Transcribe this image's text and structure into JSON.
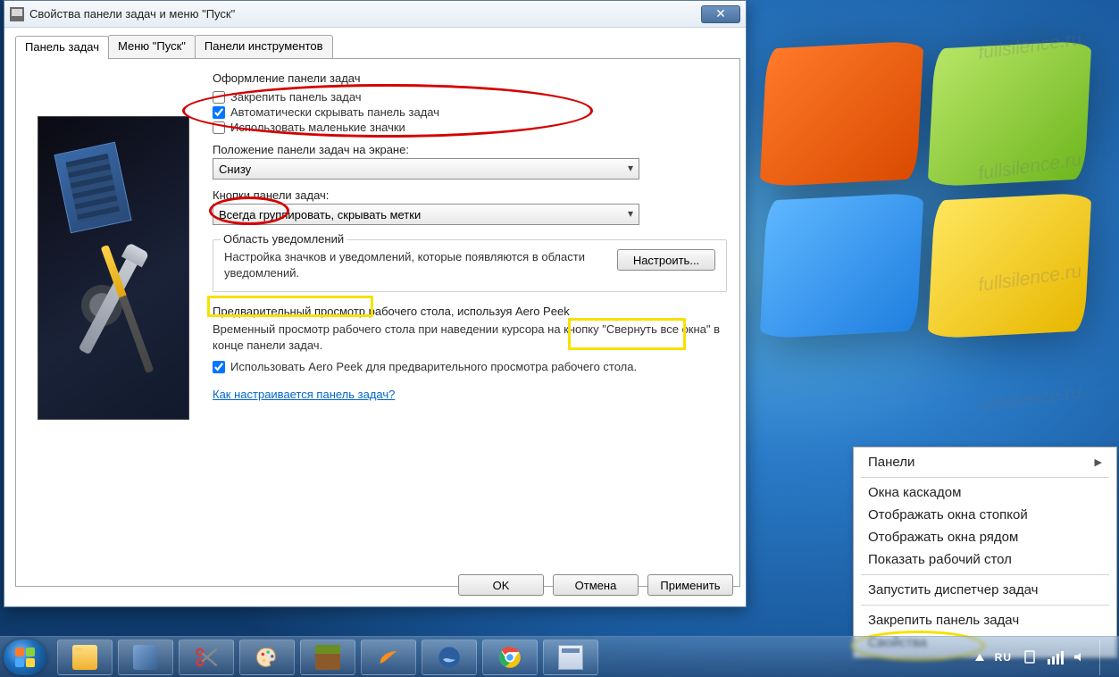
{
  "window": {
    "title": "Свойства панели задач и меню \"Пуск\""
  },
  "tabs": {
    "taskbar": "Панель задач",
    "startmenu": "Меню \"Пуск\"",
    "toolbars": "Панели инструментов"
  },
  "section_appearance": {
    "title": "Оформление панели задач",
    "lock": "Закрепить панель задач",
    "autohide": "Автоматически скрывать панель задач",
    "smallicons": "Использовать маленькие значки"
  },
  "position": {
    "label": "Положение панели задач на экране:",
    "value": "Снизу"
  },
  "buttons": {
    "label": "Кнопки панели задач:",
    "value": "Всегда группировать, скрывать метки"
  },
  "notif": {
    "legend": "Область уведомлений",
    "text": "Настройка значков и уведомлений, которые появляются в области уведомлений.",
    "btn": "Настроить..."
  },
  "aero": {
    "lead": "Предварительный просмотр рабочего стола, используя Aero Peek",
    "desc": "Временный просмотр рабочего стола при наведении курсора на кнопку \"Свернуть все окна\" в конце панели задач.",
    "check": "Использовать Aero Peek для предварительного просмотра рабочего стола."
  },
  "helplink": "Как настраивается панель задач?",
  "dlgbtn": {
    "ok": "OK",
    "cancel": "Отмена",
    "apply": "Применить"
  },
  "ctx": {
    "panels": "Панели",
    "cascade": "Окна каскадом",
    "stack": "Отображать окна стопкой",
    "side": "Отображать окна рядом",
    "showdesk": "Показать рабочий стол",
    "taskmgr": "Запустить диспетчер задач",
    "lock": "Закрепить панель задач",
    "props": "Свойства"
  },
  "tray": {
    "lang": "RU"
  },
  "watermark": "fullsilence.ru"
}
